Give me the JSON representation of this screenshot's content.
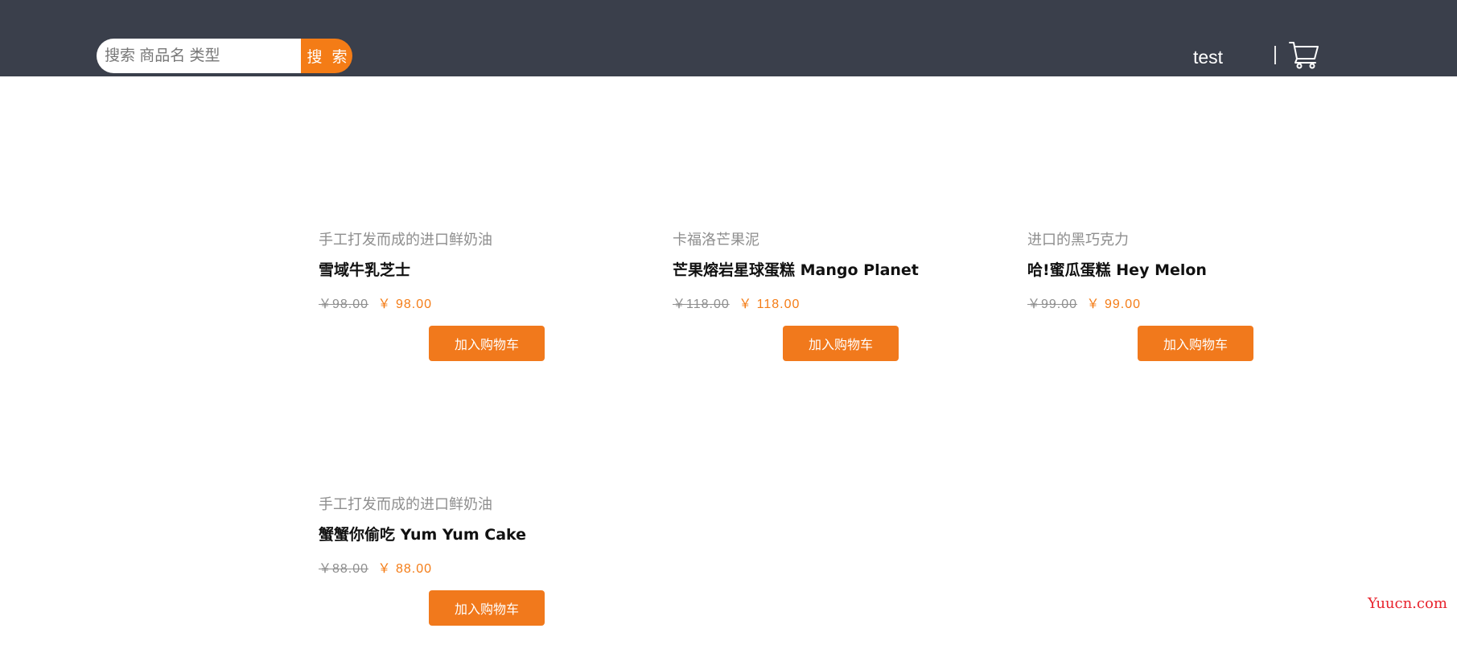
{
  "header": {
    "search_placeholder": "搜索 商品名 类型",
    "search_button": "搜 索",
    "username": "test",
    "divider": "|",
    "cart_icon": "cart-icon"
  },
  "products": [
    {
      "subtitle": "手工打发而成的进口鲜奶油",
      "title": "雪域牛乳芝士",
      "old_price": "￥98.00",
      "price": "￥ 98.00",
      "button": "加入购物车"
    },
    {
      "subtitle": "卡福洛芒果泥",
      "title": "芒果熔岩星球蛋糕 Mango Planet",
      "old_price": "￥118.00",
      "price": "￥ 118.00",
      "button": "加入购物车"
    },
    {
      "subtitle": "进口的黑巧克力",
      "title": "哈!蜜瓜蛋糕 Hey Melon",
      "old_price": "￥99.00",
      "price": "￥ 99.00",
      "button": "加入购物车"
    },
    {
      "subtitle": "手工打发而成的进口鲜奶油",
      "title": "蟹蟹你偷吃 Yum Yum Cake",
      "old_price": "￥88.00",
      "price": "￥ 88.00",
      "button": "加入购物车"
    }
  ],
  "watermark": "Yuucn.com",
  "colors": {
    "header_bg": "#3a3f4b",
    "accent": "#f47c16",
    "muted_text": "#8e8e8e",
    "watermark": "#e8232d"
  }
}
